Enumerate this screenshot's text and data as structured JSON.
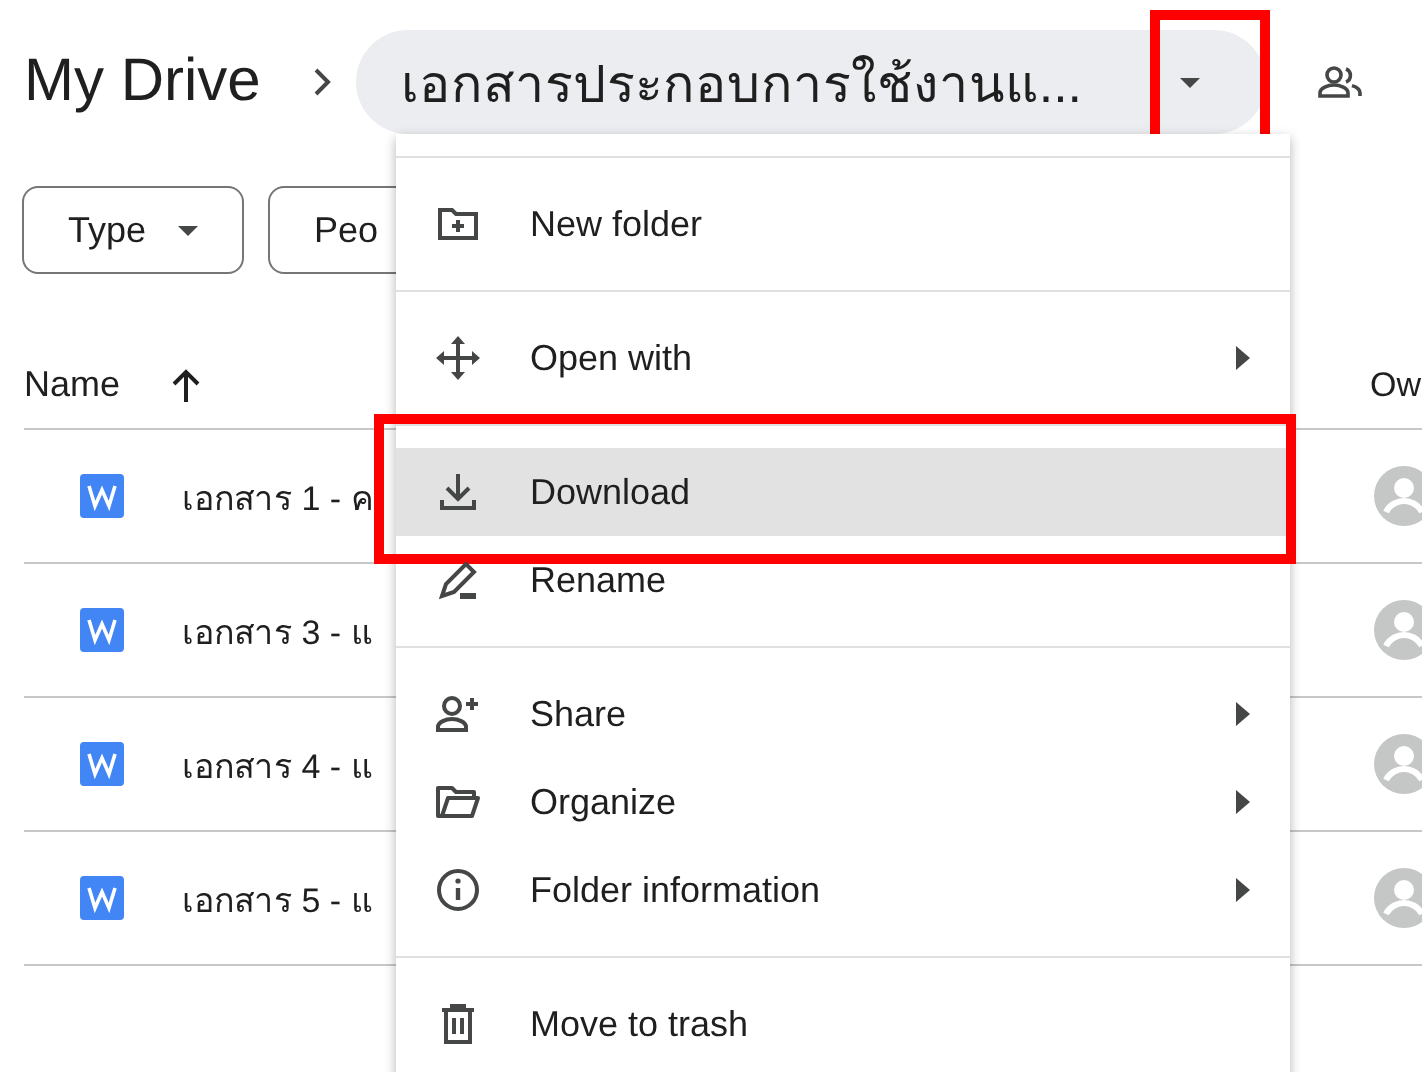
{
  "breadcrumb": {
    "root": "My Drive",
    "folder": "เอกสารประกอบการใช้งานแ...",
    "dropdown_annotated": true
  },
  "filters": [
    {
      "label": "Type",
      "dropdown": true
    },
    {
      "label": "Peo",
      "dropdown": false
    }
  ],
  "table": {
    "columns": [
      {
        "label": "Name"
      },
      {
        "label": "Ow"
      }
    ],
    "rows": [
      {
        "name": "เอกสาร 1 - ค"
      },
      {
        "name": "เอกสาร 3 - แ"
      },
      {
        "name": "เอกสาร 4 - แ"
      },
      {
        "name": "เอกสาร 5 - แ"
      }
    ]
  },
  "menu": {
    "sections": [
      [
        {
          "label": "New folder",
          "submenu": false,
          "highlighted": false,
          "annotated": false
        }
      ],
      [
        {
          "label": "Open with",
          "submenu": true,
          "highlighted": false,
          "annotated": false
        }
      ],
      [
        {
          "label": "Download",
          "submenu": false,
          "highlighted": true,
          "annotated": true
        },
        {
          "label": "Rename",
          "submenu": false,
          "highlighted": false,
          "annotated": false
        }
      ],
      [
        {
          "label": "Share",
          "submenu": true,
          "highlighted": false,
          "annotated": false
        },
        {
          "label": "Organize",
          "submenu": true,
          "highlighted": false,
          "annotated": false
        },
        {
          "label": "Folder information",
          "submenu": true,
          "highlighted": false,
          "annotated": false
        }
      ],
      [
        {
          "label": "Move to trash",
          "submenu": false,
          "highlighted": false,
          "annotated": false
        }
      ]
    ]
  }
}
